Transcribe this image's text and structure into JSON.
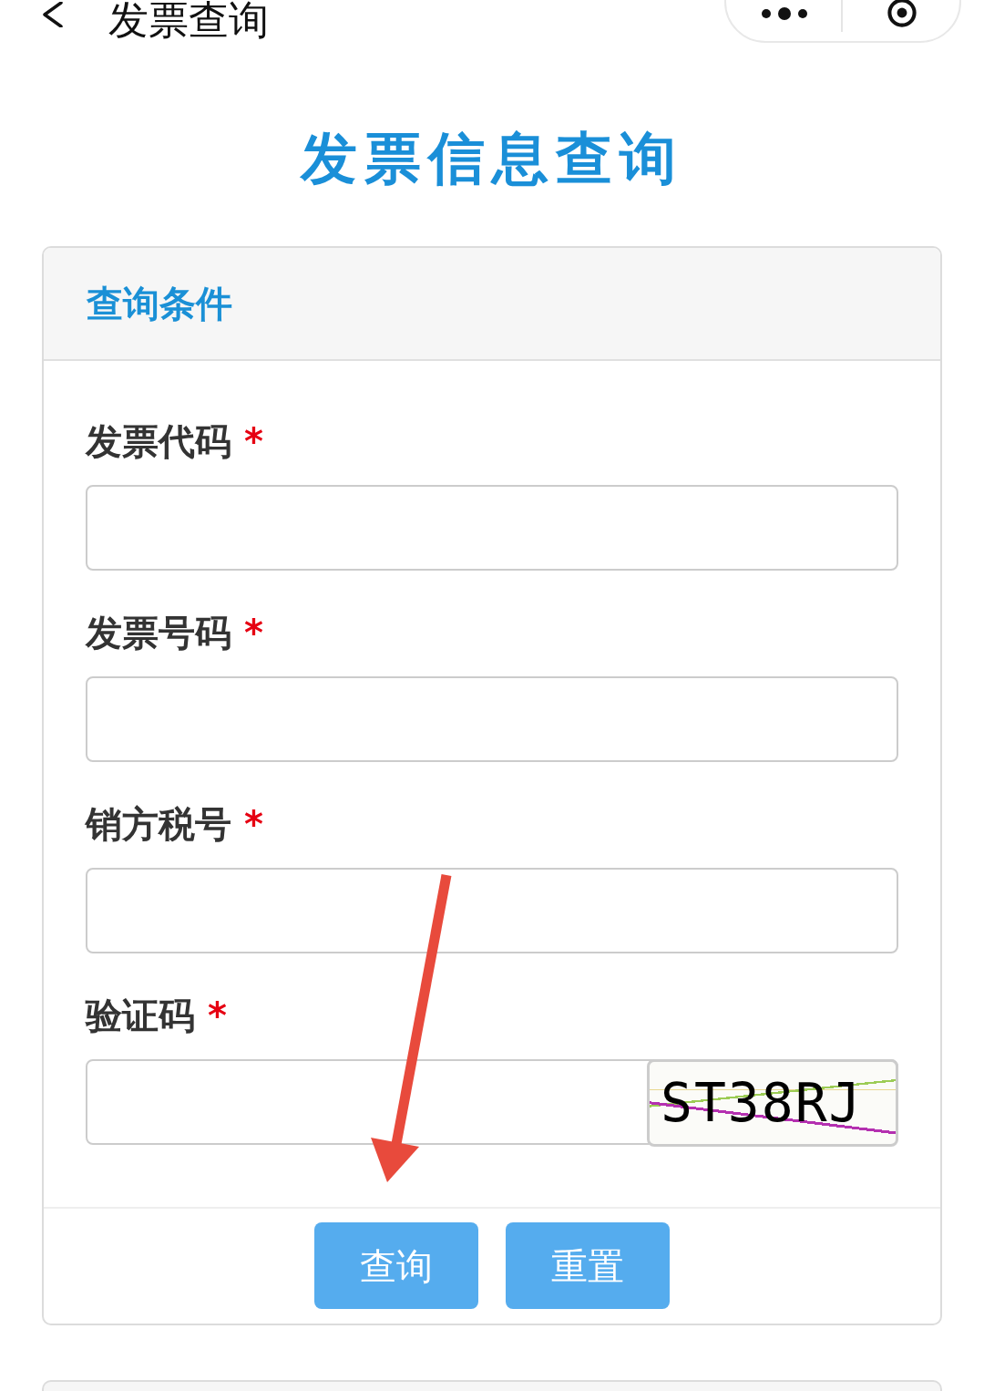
{
  "nav_bar": {
    "title": "发票查询"
  },
  "page_title": "发票信息查询",
  "query_panel": {
    "title": "查询条件",
    "fields": [
      {
        "kind": "text",
        "label": "发票代码",
        "required_mark": "*"
      },
      {
        "kind": "text",
        "label": "发票号码",
        "required_mark": "*"
      },
      {
        "kind": "text",
        "label": "销方税号",
        "required_mark": "*"
      },
      {
        "kind": "captcha",
        "label": "验证码",
        "required_mark": "*",
        "captcha_text": "ST38RJ"
      }
    ],
    "buttons": [
      {
        "label": "查询"
      },
      {
        "label": "重置"
      }
    ]
  }
}
